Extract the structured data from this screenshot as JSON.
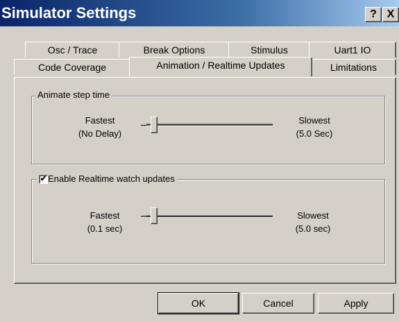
{
  "window": {
    "title": "Simulator Settings",
    "help_glyph": "?",
    "close_glyph": "X"
  },
  "tabs": {
    "row1": [
      "Osc / Trace",
      "Break Options",
      "Stimulus",
      "Uart1  IO"
    ],
    "row2": [
      "Code Coverage",
      "Animation / Realtime  Updates",
      "Limitations"
    ],
    "active": "Animation / Realtime  Updates"
  },
  "animate": {
    "group_label": "Animate step time",
    "fastest_line1": "Fastest",
    "fastest_line2": "(No Delay)",
    "slowest_line1": "Slowest",
    "slowest_line2": "(5.0 Sec)",
    "slider_level": 0.0
  },
  "realtime": {
    "checkbox_label": "Enable Realtime watch updates",
    "checked": true,
    "check_glyph": "✔",
    "fastest_line1": "Fastest",
    "fastest_line2": "(0.1 sec)",
    "slowest_line1": "Slowest",
    "slowest_line2": "(5.0 sec)",
    "slider_level": 0.0
  },
  "buttons": {
    "ok": "OK",
    "cancel": "Cancel",
    "apply": "Apply"
  }
}
